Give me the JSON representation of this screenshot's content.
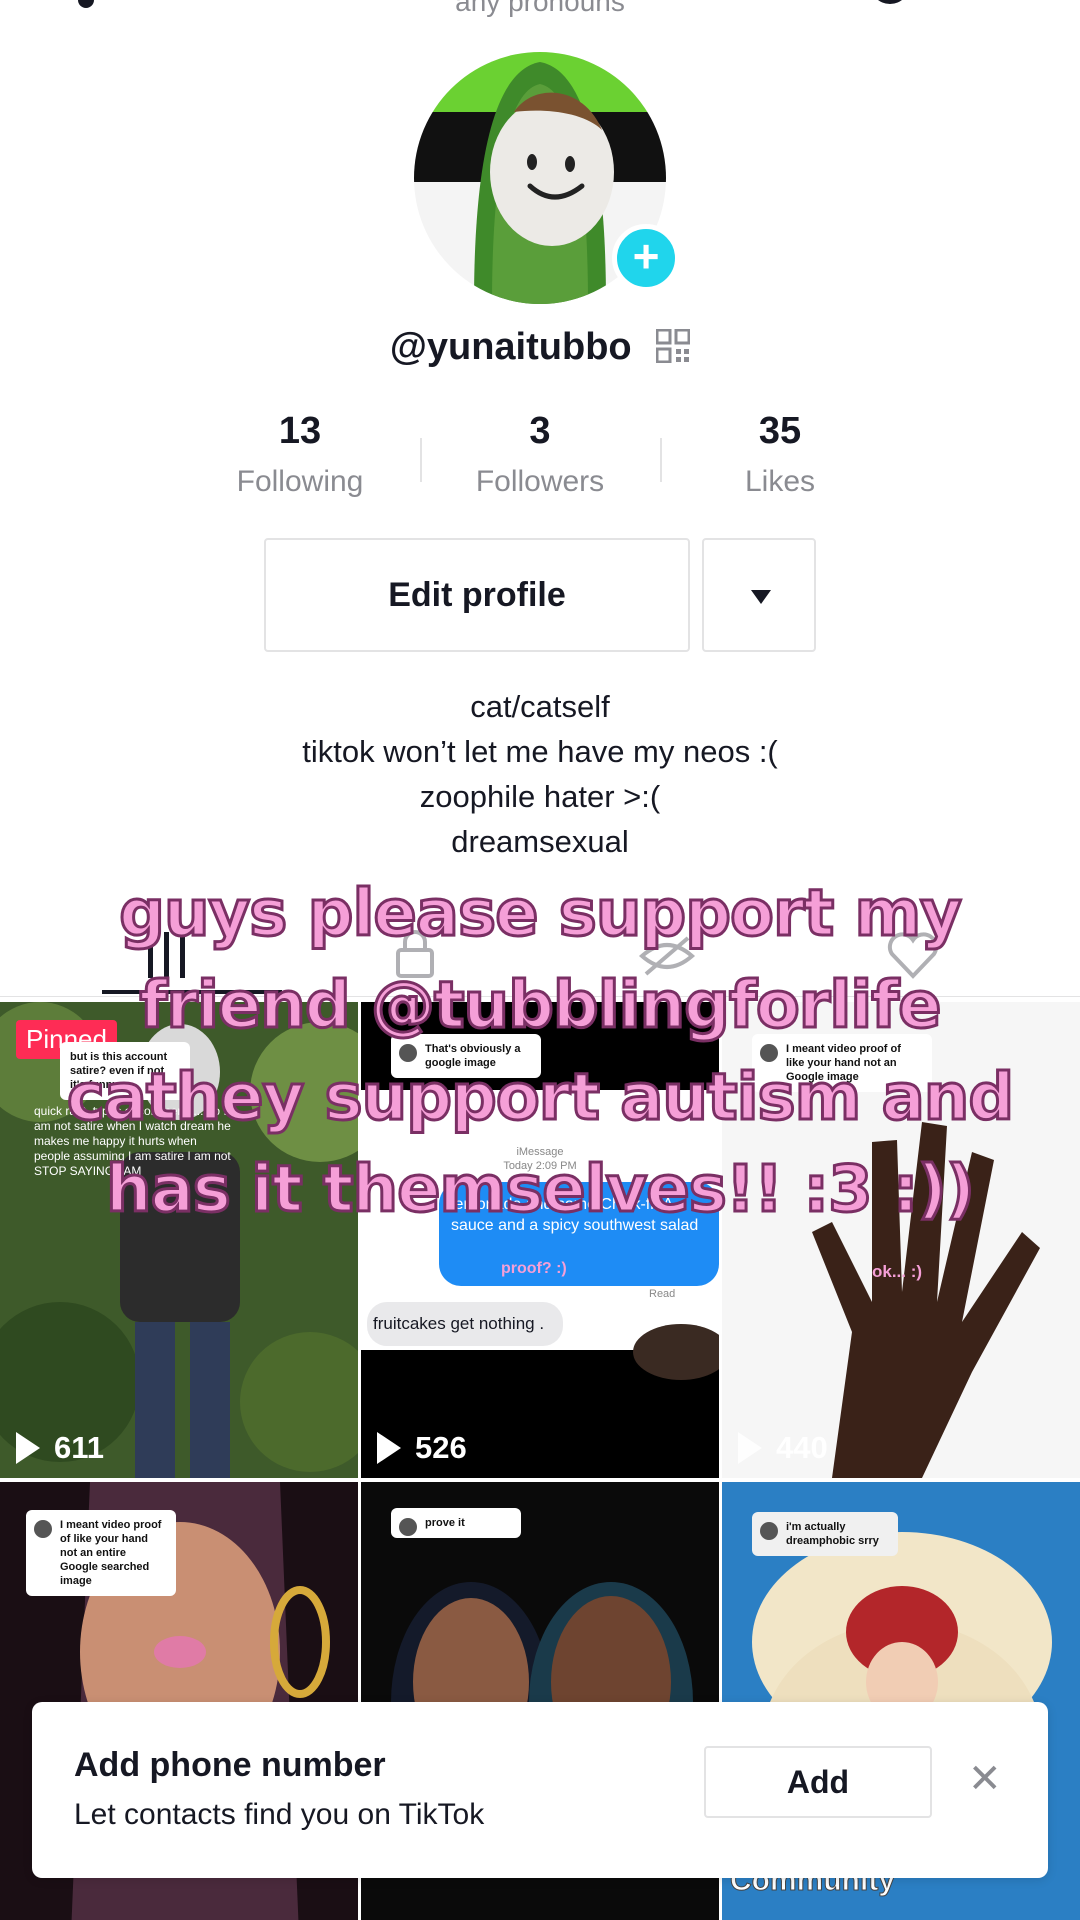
{
  "profile": {
    "pronouns": "any pronouns",
    "username": "@yunaitubbo",
    "avatar_icon": "avatar-image",
    "add_icon": "plus-icon",
    "qr_icon": "qr-code-icon"
  },
  "stats": [
    {
      "value": "13",
      "label": "Following"
    },
    {
      "value": "3",
      "label": "Followers"
    },
    {
      "value": "35",
      "label": "Likes"
    }
  ],
  "buttons": {
    "edit_profile": "Edit profile"
  },
  "bio": {
    "lines": [
      "cat/catself",
      "tiktok won’t let me have my neos :(",
      "zoophile hater >:(",
      "dreamsexual"
    ]
  },
  "overlay": {
    "lines": [
      "guys please support my",
      "friend @tubblingforlife",
      "cathey support autism and",
      "has it themselves!! :3 :))"
    ]
  },
  "tabs": [
    {
      "icon": "grid-icon"
    },
    {
      "icon": "lock-icon"
    },
    {
      "icon": "hidden-eye-icon"
    },
    {
      "icon": "heart-icon"
    }
  ],
  "videos": [
    {
      "views": "611",
      "pinned": "Pinned",
      "comment": "but is this account satire? even if not it's funny",
      "caption": "quick rant. types of comments... no I am not satire when I watch dream he makes me happy it hurts when people assuming I am satire I am not STOP SAYING I AM"
    },
    {
      "views": "526",
      "comment": "That's obviously a google image",
      "message_header": "iMessage",
      "message_time": "Today 2:09 PM",
      "bubble": "lemonade and some Chick-fil-A sauce and a spicy southwest salad",
      "pink_label": "proof? :)",
      "read": "Read",
      "reply": "fruitcakes get nothing ."
    },
    {
      "views": "440",
      "comment": "I meant video proof of like your hand not an Google image",
      "pink_label": "ok... :)"
    },
    {
      "comment": "I meant video proof of like your hand not an entire Google searched image"
    },
    {
      "comment": "prove it"
    },
    {
      "comment": "i'm actually dreamphobic srry",
      "caption": "Community"
    }
  ],
  "banner": {
    "title": "Add phone number",
    "subtitle": "Let contacts find you on TikTok",
    "add": "Add",
    "close": "✕"
  },
  "colors": {
    "accent": "#20d5ec",
    "pinned": "#fe2c55",
    "overlay_text": "#f59fd7",
    "bubble": "#1e8cf5"
  }
}
